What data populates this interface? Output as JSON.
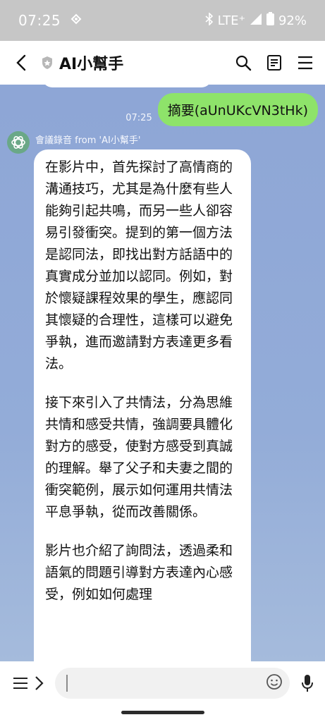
{
  "status_bar": {
    "time": "07:25",
    "network": "LTE⁺",
    "battery": "92%"
  },
  "header": {
    "title": "AI小幫手"
  },
  "chat": {
    "user_message": {
      "time": "07:25",
      "text": "摘要(aUnUKcVN3tHk)"
    },
    "bot_message": {
      "sender": "會議錄音 from 'AI小幫手'",
      "paragraphs": [
        "在影片中，首先探討了高情商的溝通技巧，尤其是為什麼有些人能夠引起共鳴，而另一些人卻容易引發衝突。提到的第一個方法是認同法，即找出對方話語中的真實成分並加以認同。例如，對於懷疑課程效果的學生，應認同其懷疑的合理性，這樣可以避免爭執，進而邀請對方表達更多看法。",
        "接下來引入了共情法，分為思維共情和感受共情，強調要具體化對方的感受，使對方感受到真誠的理解。舉了父子和夫妻之間的衝突範例，展示如何運用共情法平息爭執，從而改善關係。",
        "影片也介紹了詢問法，透過柔和語氣的問題引導對方表達內心感受，例如如何處理"
      ]
    }
  },
  "icons": {
    "wifi_calling": "wifi-calling-icon",
    "bluetooth": "bluetooth-icon",
    "signal": "signal-icon",
    "battery": "battery-icon",
    "back": "chevron-left-icon",
    "shield": "shield-icon",
    "search": "search-icon",
    "notes": "notes-icon",
    "menu": "hamburger-icon",
    "bot_avatar": "chatgpt-logo-icon",
    "more_menu": "menu-icon",
    "expand": "chevron-right-icon",
    "emoji": "emoji-icon",
    "mic": "microphone-icon"
  },
  "colors": {
    "chat_background": "#8fa8d4",
    "user_bubble": "#8ee36a",
    "bot_bubble": "#ffffff",
    "status_bar": "#c6c6c6"
  }
}
